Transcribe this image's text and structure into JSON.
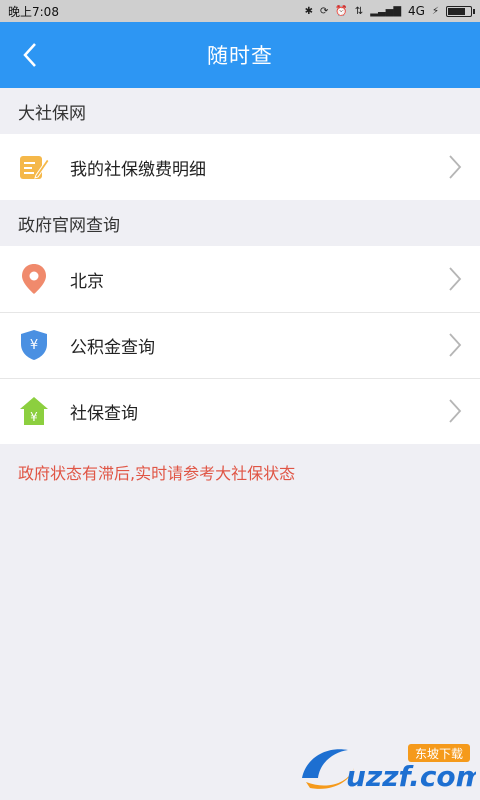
{
  "status_bar": {
    "time": "晚上7:08",
    "network": "4G"
  },
  "header": {
    "title": "随时查"
  },
  "sections": [
    {
      "title": "大社保网",
      "items": [
        {
          "label": "我的社保缴费明细",
          "icon": "edit-note-icon"
        }
      ]
    },
    {
      "title": "政府官网查询",
      "items": [
        {
          "label": "北京",
          "icon": "location-pin-icon"
        },
        {
          "label": "公积金查询",
          "icon": "yen-shield-icon"
        },
        {
          "label": "社保查询",
          "icon": "yen-house-icon"
        }
      ]
    }
  ],
  "notice": "政府状态有滞后,实时请参考大社保状态",
  "watermark": {
    "brand": "uzzf.com",
    "tag": "东坡下载"
  },
  "colors": {
    "header": "#2d96f3",
    "notice": "#e05545",
    "pin": "#f08a6c",
    "shield": "#4a90e2",
    "house": "#8ccf3f",
    "note": "#f5b84a"
  }
}
